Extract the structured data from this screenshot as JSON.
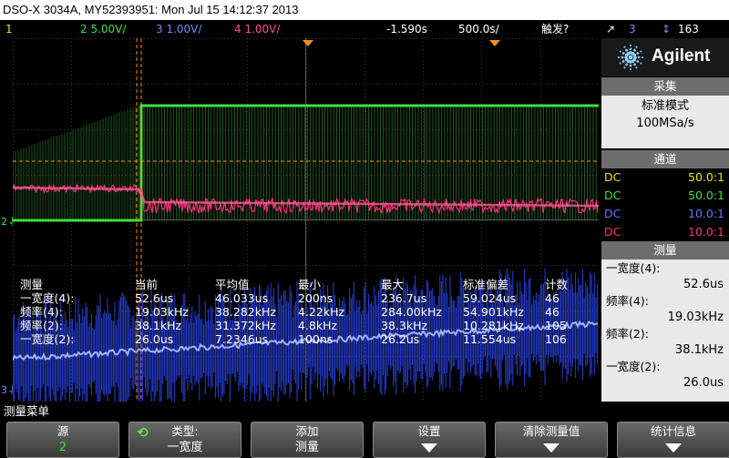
{
  "title": "DSO-X 3034A, MY52393951: Mon Jul 15 14:12:37 2013",
  "status": {
    "ch1_label": "1",
    "ch2": "2  5.00V/",
    "ch3": "3  1.00V/",
    "ch4": "4  1.00V/",
    "time_offset": "-1.590s",
    "timebase": "500.0s/",
    "trigger_label": "触发?",
    "trigger_source": "3",
    "trigger_level": "163"
  },
  "colors": {
    "ch1": "#f2e200",
    "ch2": "#3ee03e",
    "ch3": "#4b6cff",
    "ch4": "#ff2f7d",
    "trigger": "#ff8c1a"
  },
  "brand": {
    "name": "Agilent"
  },
  "acquisition": {
    "header": "采集",
    "mode": "标准模式",
    "rate": "100MSa/s"
  },
  "channels": {
    "header": "通道",
    "rows": [
      {
        "coupling": "DC",
        "value": "50.0:1"
      },
      {
        "coupling": "DC",
        "value": "50.0:1"
      },
      {
        "coupling": "DC",
        "value": "10.0:1"
      },
      {
        "coupling": "DC",
        "value": "10.0:1"
      }
    ]
  },
  "side_measure": {
    "header": "测量",
    "items": [
      {
        "label": "一宽度(4):",
        "value": "52.6us"
      },
      {
        "label": "频率(4):",
        "value": "19.03kHz"
      },
      {
        "label": "频率(2):",
        "value": "38.1kHz"
      },
      {
        "label": "一宽度(2):",
        "value": "26.0us"
      }
    ]
  },
  "measurements": {
    "headers": [
      "测量",
      "当前",
      "平均值",
      "最小",
      "最大",
      "标准偏差",
      "计数"
    ],
    "rows": [
      [
        "一宽度(4):",
        "52.6us",
        "46.033us",
        "200ns",
        "236.7us",
        "59.024us",
        "46"
      ],
      [
        "频率(4):",
        "19.03kHz",
        "38.282kHz",
        "4.22kHz",
        "284.00kHz",
        "54.901kHz",
        "46"
      ],
      [
        "频率(2):",
        "38.1kHz",
        "31.372kHz",
        "4.8kHz",
        "38.3kHz",
        "10.281kHz",
        "105"
      ],
      [
        "一宽度(2):",
        "26.0us",
        "7.2346us",
        "100ns",
        "26.2us",
        "11.554us",
        "106"
      ]
    ]
  },
  "markers": {
    "ch2": "2",
    "ch3": "3"
  },
  "menu_title": "测量菜单",
  "softkeys": [
    {
      "top": "源",
      "bottom": "2"
    },
    {
      "top": "类型:",
      "bottom": "一宽度"
    },
    {
      "top": "添加",
      "bottom": "测量"
    },
    {
      "top": "设置",
      "bottom": ""
    },
    {
      "top": "清除测量值",
      "bottom": ""
    },
    {
      "top": "统计信息",
      "bottom": ""
    }
  ]
}
